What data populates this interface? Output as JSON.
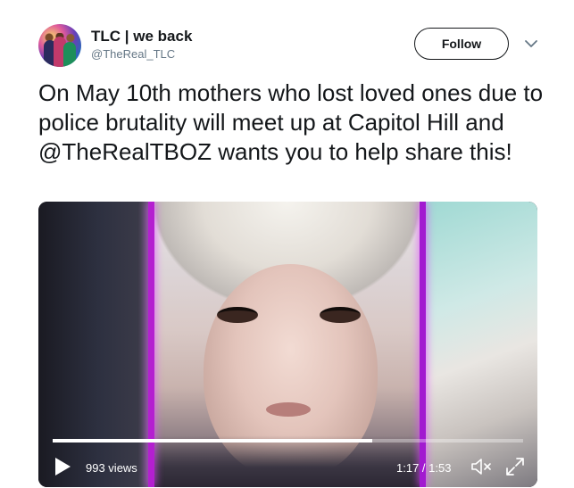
{
  "tweet": {
    "display_name": "TLC | we back",
    "handle": "@TheReal_TLC",
    "follow_label": "Follow",
    "text": "On May 10th mothers who lost loved ones due to police brutality will meet up at Capitol Hill and @TheRealTBOZ wants you to help share this!"
  },
  "video": {
    "views": "993 views",
    "time": "1:17 / 1:53",
    "progress": 0.68
  },
  "icons": {
    "play": "play-icon",
    "mute": "mute-icon",
    "fullscreen": "fullscreen-icon",
    "caret": "chevron-down-icon"
  },
  "colors": {
    "text": "#14171a",
    "secondary_text": "#657786",
    "caret": "#657786",
    "neon": "#b41fd0"
  }
}
